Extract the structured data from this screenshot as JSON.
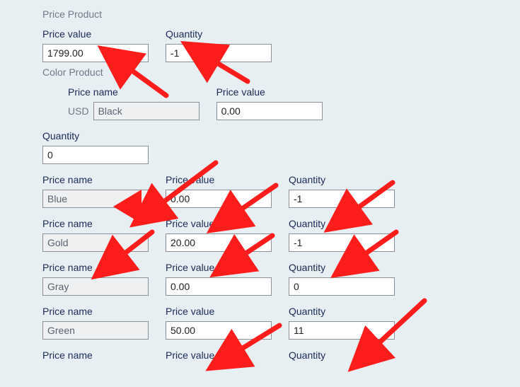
{
  "sections": {
    "price_product_title": "Price Product",
    "color_product_title": "Color Product"
  },
  "base": {
    "price_value_label": "Price value",
    "price_value": "1799.00",
    "quantity_label": "Quantity",
    "quantity": "-1"
  },
  "currency_prefix": "USD",
  "color0": {
    "price_name_label": "Price name",
    "price_name": "Black",
    "price_value_label": "Price value",
    "price_value": "0.00",
    "quantity_label": "Quantity",
    "quantity": "0"
  },
  "color_rows": [
    {
      "name": "Blue",
      "value": "0.00",
      "qty": "-1"
    },
    {
      "name": "Gold",
      "value": "20.00",
      "qty": "-1"
    },
    {
      "name": "Gray",
      "value": "0.00",
      "qty": "0"
    },
    {
      "name": "Green",
      "value": "50.00",
      "qty": "11"
    }
  ],
  "labels": {
    "price_name": "Price name",
    "price_value": "Price value",
    "quantity": "Quantity"
  }
}
